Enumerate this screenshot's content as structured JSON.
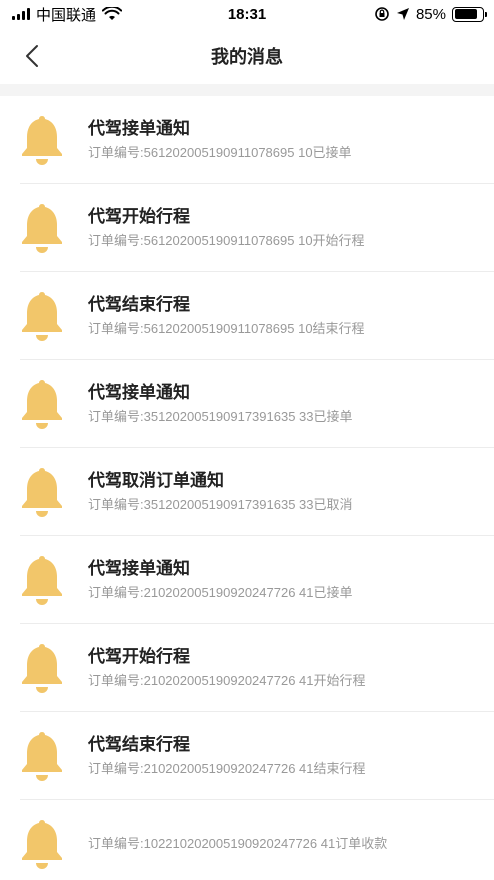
{
  "status_bar": {
    "carrier": "中国联通",
    "time": "18:31",
    "battery": "85%",
    "battery_level": 0.85
  },
  "nav": {
    "title": "我的消息"
  },
  "colors": {
    "bell": "#F2C66A",
    "separator": "#F4F4F4",
    "subtext": "#999999"
  },
  "messages": [
    {
      "title": "代驾接单通知",
      "body": "订单编号:561202005190911078695 10已接单"
    },
    {
      "title": "代驾开始行程",
      "body": "订单编号:561202005190911078695 10开始行程"
    },
    {
      "title": "代驾结束行程",
      "body": "订单编号:561202005190911078695 10结束行程"
    },
    {
      "title": "代驾接单通知",
      "body": "订单编号:351202005190917391635 33已接单"
    },
    {
      "title": "代驾取消订单通知",
      "body": "订单编号:351202005190917391635 33已取消"
    },
    {
      "title": "代驾接单通知",
      "body": "订单编号:210202005190920247726 41已接单"
    },
    {
      "title": "代驾开始行程",
      "body": "订单编号:210202005190920247726 41开始行程"
    },
    {
      "title": "代驾结束行程",
      "body": "订单编号:210202005190920247726 41结束行程"
    },
    {
      "title": "",
      "body": "订单编号:102210202005190920247726 41订单收款"
    }
  ]
}
